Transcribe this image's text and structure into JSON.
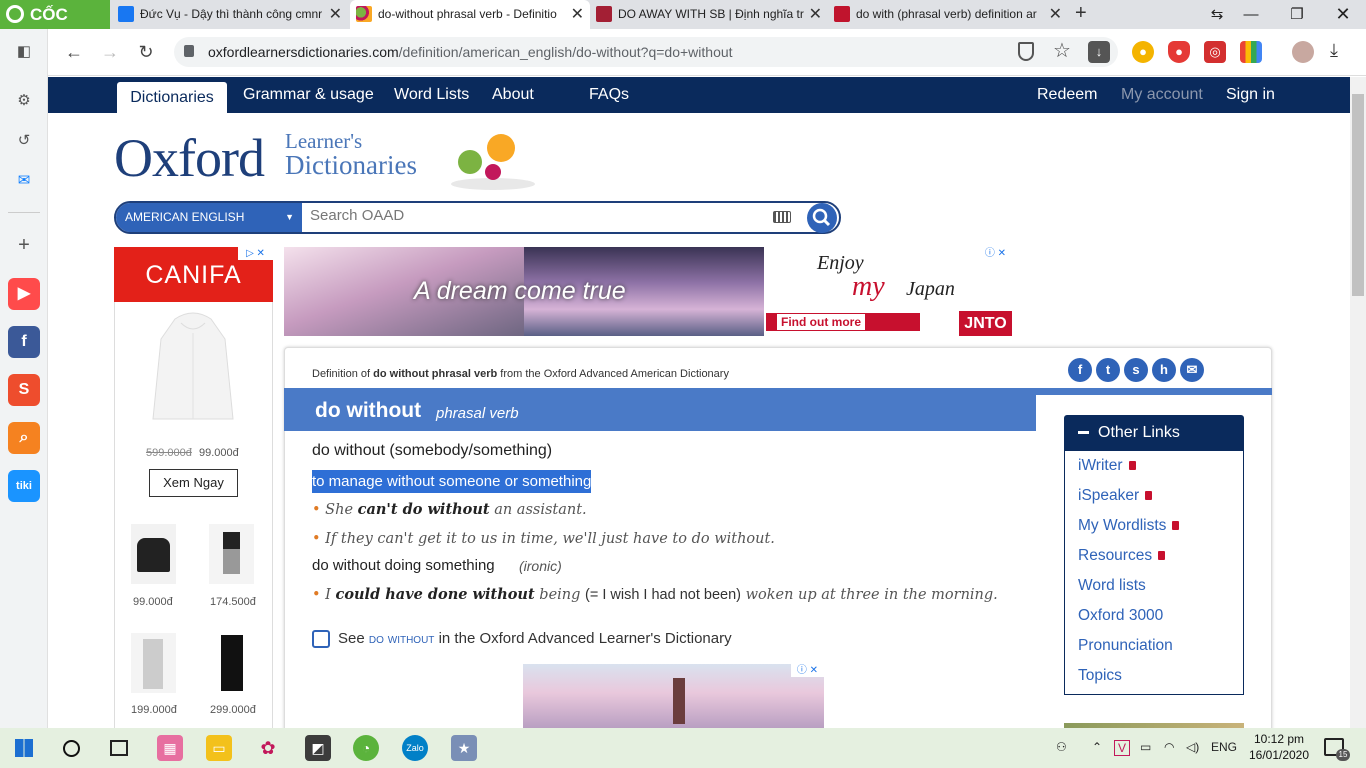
{
  "browser": {
    "brand": "CỐC CỐC",
    "tabs": [
      {
        "title": "Đức Vụ - Dậy thì thành công cmnr",
        "icon": "facebook-icon"
      },
      {
        "title": "do-without phrasal verb - Definitio",
        "icon": "oxford-icon"
      },
      {
        "title": "DO AWAY WITH SB | Định nghĩa tr",
        "icon": "cambridge-icon"
      },
      {
        "title": "do with (phrasal verb) definition ar",
        "icon": "macmillan-icon"
      }
    ],
    "url_domain": "oxfordlearnersdictionaries.com",
    "url_path": "/definition/american_english/do-without?q=do+without"
  },
  "site_nav": {
    "left": [
      "Dictionaries",
      "Grammar & usage",
      "Word Lists",
      "About",
      "FAQs"
    ],
    "right": [
      "Redeem",
      "My account",
      "Sign in"
    ]
  },
  "logo": {
    "oxford": "Oxford",
    "line1": "Learner's",
    "line2": "Dictionaries"
  },
  "search": {
    "language": "AMERICAN ENGLISH",
    "placeholder": "Search OAAD"
  },
  "left_ad": {
    "brand": "CANIFA",
    "old_price": "599.000đ",
    "price": "99.000đ",
    "button": "Xem Ngay",
    "products": [
      {
        "price": "99.000đ"
      },
      {
        "price": "174.500đ"
      },
      {
        "price": "199.000đ"
      },
      {
        "price": "299.000đ"
      }
    ]
  },
  "banner_ad": {
    "headline": "A dream come true",
    "enjoy": "Enjoy",
    "my": "my",
    "japan": "Japan",
    "cta": "Find out more",
    "brand": "JNTO"
  },
  "entry": {
    "source_prefix": "Definition of",
    "source_bold": "do without phrasal verb",
    "source_suffix": "from the Oxford Advanced American Dictionary",
    "headword": "do without",
    "pos": "phrasal verb",
    "sense1_pattern": "do without (somebody/something)",
    "sense1_def": "to manage without someone or something",
    "ex1_a": "She ",
    "ex1_b": "can't do without",
    "ex1_c": " an assistant.",
    "ex2": "If they can't get it to us in time, we'll just have to do without.",
    "sense2_pattern": "do without doing something",
    "sense2_label": "(ironic)",
    "ex3_a": "I ",
    "ex3_b": "could have done without",
    "ex3_c": " being ",
    "ex3_gloss": "(= I wish I had not been)",
    "ex3_d": " woken up at three in the morning.",
    "see_prefix": "See",
    "see_link": "do without",
    "see_suffix": "in the Oxford Advanced Learner's Dictionary"
  },
  "other_links": {
    "title": "Other Links",
    "items": [
      {
        "label": "iWriter",
        "locked": true
      },
      {
        "label": "iSpeaker",
        "locked": true
      },
      {
        "label": "My Wordlists",
        "locked": true
      },
      {
        "label": "Resources",
        "locked": true
      },
      {
        "label": "Word lists",
        "locked": false
      },
      {
        "label": "Oxford 3000",
        "locked": false
      },
      {
        "label": "Pronunciation",
        "locked": false
      },
      {
        "label": "Topics",
        "locked": false
      }
    ]
  },
  "taskbar": {
    "lang": "ENG",
    "time": "10:12 pm",
    "date": "16/01/2020",
    "notifications": "15"
  }
}
